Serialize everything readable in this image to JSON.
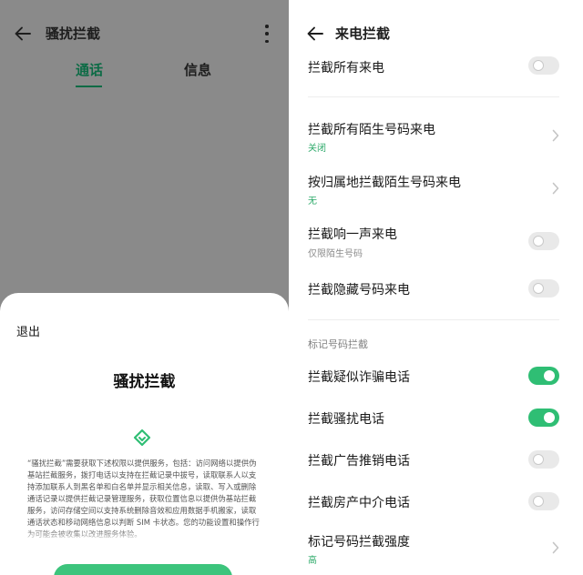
{
  "left": {
    "title": "骚扰拦截",
    "tabs": [
      {
        "label": "通话",
        "active": true
      },
      {
        "label": "信息",
        "active": false
      }
    ],
    "dialog": {
      "exit_label": "退出",
      "title": "骚扰拦截",
      "body": "“骚扰拦截”需要获取下述权限以提供服务，包括：访问网络以提供伪基站拦截服务，拨打电话以支持在拦截记录中拔号，读取联系人以支持添加联系人到黑名单和白名单并显示相关信息，读取、写入或删除通话记录以提供拦截记录管理服务，获取位置信息以提供伪基站拦截服务，访问存储空间以支持系统删除音效和应用数据手机搬家，读取通话状态和移动网络信息以判断 SIM 卡状态。您的功能设置和操作行为可能会被收集以改进服务体验。"
    }
  },
  "right": {
    "title": "来电拦截",
    "rows": [
      {
        "label": "拦截所有来电",
        "control": "toggle",
        "on": false
      },
      {
        "label": "拦截所有陌生号码来电",
        "sub": "关闭",
        "control": "chevron"
      },
      {
        "label": "按归属地拦截陌生号码来电",
        "sub": "无",
        "control": "chevron"
      },
      {
        "label": "拦截响一声来电",
        "sub": "仅限陌生号码",
        "control": "toggle",
        "on": false
      },
      {
        "label": "拦截隐藏号码来电",
        "control": "toggle",
        "on": false
      }
    ],
    "marked_section": {
      "header": "标记号码拦截",
      "rows": [
        {
          "label": "拦截疑似诈骗电话",
          "control": "toggle",
          "on": true
        },
        {
          "label": "拦截骚扰电话",
          "control": "toggle",
          "on": true
        },
        {
          "label": "拦截广告推销电话",
          "control": "toggle",
          "on": false
        },
        {
          "label": "拦截房产中介电话",
          "control": "toggle",
          "on": false
        },
        {
          "label": "标记号码拦截强度",
          "sub": "高",
          "control": "chevron"
        }
      ]
    }
  },
  "colors": {
    "accent": "#2fbe74",
    "tab_active": "#0c6b45",
    "overlay": "#8a8a8a"
  }
}
